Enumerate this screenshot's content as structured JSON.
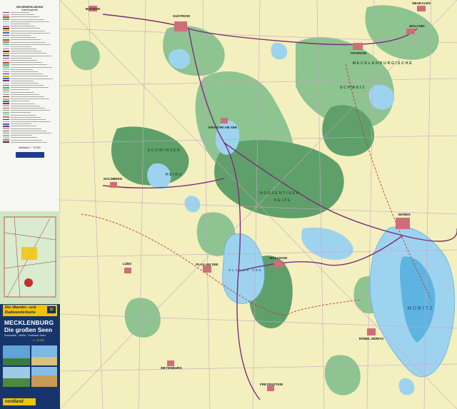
{
  "map": {
    "places": [
      {
        "name": "BÜTZOW",
        "kind": "town"
      },
      {
        "name": "GÜSTROW",
        "kind": "town"
      },
      {
        "name": "TETEROW",
        "kind": "town"
      },
      {
        "name": "NEUKALEN",
        "kind": "town"
      },
      {
        "name": "MALCHIN",
        "kind": "town"
      },
      {
        "name": "KRAKOW AM SEE",
        "kind": "town"
      },
      {
        "name": "GOLDBERG",
        "kind": "town"
      },
      {
        "name": "LÜBZ",
        "kind": "town"
      },
      {
        "name": "PLAU AM SEE",
        "kind": "town"
      },
      {
        "name": "MALCHOW",
        "kind": "town"
      },
      {
        "name": "WAREN",
        "kind": "town"
      },
      {
        "name": "RÖBEL MÜRITZ",
        "kind": "town"
      },
      {
        "name": "MEYENBURG",
        "kind": "town"
      },
      {
        "name": "FREYENSTEIN",
        "kind": "town"
      }
    ],
    "regions": [
      {
        "name": "NOSSENTINER",
        "kind": "heath"
      },
      {
        "name": "HEIDE",
        "kind": "heath"
      },
      {
        "name": "SCHWINZER",
        "kind": "heath"
      },
      {
        "name": "HEIDE",
        "kind": "heath"
      },
      {
        "name": "MECKLENBURGISCHE",
        "kind": "region"
      },
      {
        "name": "SCHWEIZ",
        "kind": "region"
      }
    ],
    "lakes": [
      {
        "name": "MÜRITZ"
      },
      {
        "name": "PLAUER SEE"
      }
    ],
    "colors": {
      "farmland": "#f4efbf",
      "forest": "#5fa06a",
      "forest_light": "#8dc490",
      "water": "#9ed3ef",
      "water_deep": "#5eb4e0",
      "road_main": "#7a2f7a",
      "road_minor": "#c6a6c2",
      "route": "#c0392b",
      "settlement": "#cf6e78"
    }
  },
  "legend": {
    "heading": "ZEICHENERKLÄRUNG",
    "subheading": "Kartenlegende",
    "scale": "Maßstab 1 : 75 000"
  },
  "cover": {
    "series_line1": "Die Wander- und",
    "series_line2": "Radwanderkarte",
    "series_num": "32",
    "title_line1": "MECKLENBURG",
    "title_line2": "Die großen Seen",
    "subtitle": "Seenplatte · Müritz · Krakower Seen",
    "scale": "1 : 75 000",
    "brand": "nordland"
  }
}
